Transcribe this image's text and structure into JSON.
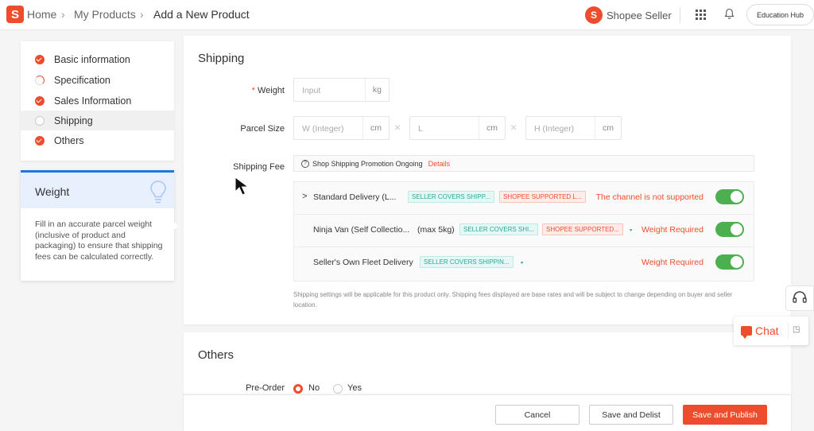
{
  "header": {
    "logo_letter": "S",
    "breadcrumbs": [
      "Home",
      "My Products",
      "Add a New Product"
    ],
    "seller_logo_letter": "S",
    "seller_label": "Shopee Seller",
    "education_hub": "Education Hub"
  },
  "sidebar": {
    "items": [
      {
        "label": "Basic information",
        "state": "done"
      },
      {
        "label": "Specification",
        "state": "partial"
      },
      {
        "label": "Sales Information",
        "state": "done"
      },
      {
        "label": "Shipping",
        "state": "empty"
      },
      {
        "label": "Others",
        "state": "done"
      }
    ]
  },
  "tip": {
    "title": "Weight",
    "body": "Fill in an accurate parcel weight (inclusive of product and packaging) to ensure that shipping fees can be calculated correctly."
  },
  "shipping": {
    "title": "Shipping",
    "weight_required_mark": "*",
    "weight_label": "Weight",
    "weight_placeholder": "Input",
    "weight_unit": "kg",
    "parcel_label": "Parcel Size",
    "parcel_fields": [
      {
        "placeholder": "W (Integer)",
        "unit": "cm"
      },
      {
        "placeholder": "L",
        "unit": "cm"
      },
      {
        "placeholder": "H (Integer)",
        "unit": "cm"
      }
    ],
    "times_symbol": "×",
    "fee_label": "Shipping Fee",
    "promo_icon": "?",
    "promo_text": "Shop Shipping Promotion Ongoing",
    "promo_link": "Details",
    "channels": [
      {
        "chevron": ">",
        "name": "Standard Delivery (L...",
        "extra": "",
        "tags": [
          "SELLER COVERS SHIPP...",
          "SHOPEE SUPPORTED L..."
        ],
        "status": "The channel is not supported",
        "enabled": true
      },
      {
        "chevron": "",
        "name": "Ninja Van (Self Collectio...",
        "extra": "(max 5kg)",
        "tags": [
          "SELLER COVERS SHI...",
          "SHOPEE SUPPORTED..."
        ],
        "status": "Weight Required",
        "enabled": true
      },
      {
        "chevron": "",
        "name": "Seller's Own Fleet Delivery",
        "extra": "",
        "tags": [
          "SELLER COVERS SHIPPIN..."
        ],
        "status": "Weight Required",
        "enabled": true
      }
    ],
    "note": "Shipping settings will be applicable for this product only. Shipping fees displayed are base rates and will be subject to change depending on buyer and seller location."
  },
  "others": {
    "title": "Others",
    "preorder_label": "Pre-Order",
    "options": [
      {
        "label": "No",
        "selected": true
      },
      {
        "label": "Yes",
        "selected": false
      }
    ]
  },
  "footer": {
    "cancel": "Cancel",
    "save_delist": "Save and Delist",
    "save_publish": "Save and Publish"
  },
  "chat": {
    "label": "Chat"
  },
  "colors": {
    "brand": "#ee4d2d",
    "toggle_on": "#4caf50",
    "tag_teal": "#26aa99",
    "tip_accent": "#2673dd"
  }
}
